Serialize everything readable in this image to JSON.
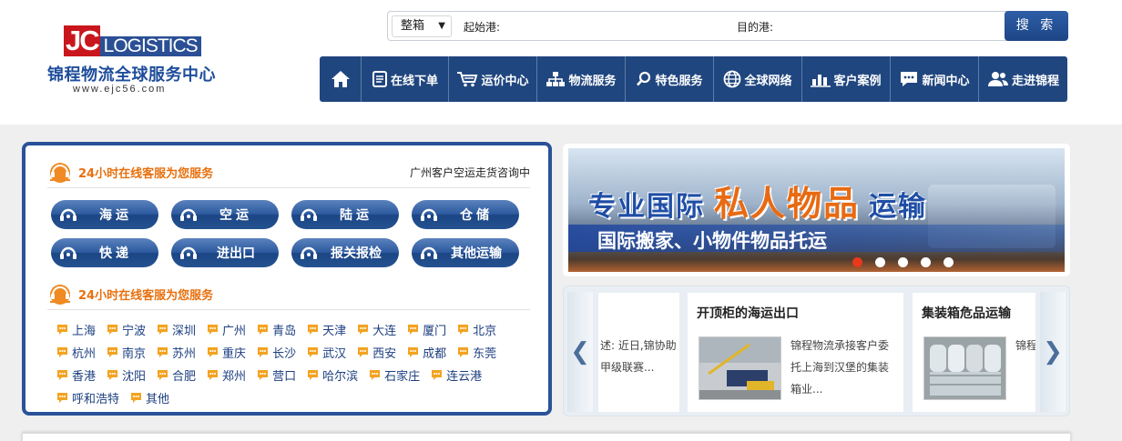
{
  "header": {
    "logo": {
      "jc": "JC",
      "logistics": "LOGISTICS",
      "cn_name": "锦程物流全球服务中心",
      "url": "www.ejc56.com"
    },
    "search": {
      "type_value": "整箱",
      "from_label": "起始港:",
      "to_label": "目的港:",
      "button_label": "搜 索"
    },
    "nav": [
      {
        "label": "",
        "icon": "home-icon"
      },
      {
        "label": "在线下单",
        "icon": "document-icon"
      },
      {
        "label": "运价中心",
        "icon": "cart-icon"
      },
      {
        "label": "物流服务",
        "icon": "sitemap-icon"
      },
      {
        "label": "特色服务",
        "icon": "search-icon"
      },
      {
        "label": "全球网络",
        "icon": "globe-icon"
      },
      {
        "label": "客户案例",
        "icon": "bar-chart-icon"
      },
      {
        "label": "新闻中心",
        "icon": "chat-icon"
      },
      {
        "label": "走进锦程",
        "icon": "users-icon"
      }
    ]
  },
  "service_panel": {
    "title1": "24小时在线客服为您服务",
    "right_text": "广州客户空运走货咨询中",
    "services": [
      "海运",
      "空运",
      "陆运",
      "仓储",
      "快递",
      "进出口",
      "报关报检",
      "其他运输"
    ],
    "title2": "24小时在线客服为您服务",
    "cities": [
      [
        "上海",
        "宁波",
        "深圳",
        "广州",
        "青岛",
        "天津",
        "大连",
        "厦门",
        "北京"
      ],
      [
        "杭州",
        "南京",
        "苏州",
        "重庆",
        "长沙",
        "武汉",
        "西安",
        "成都",
        "东莞"
      ],
      [
        "香港",
        "沈阳",
        "合肥",
        "郑州",
        "营口",
        "哈尔滨",
        "石家庄",
        "连云港"
      ],
      [
        "呼和浩特",
        "其他"
      ]
    ]
  },
  "banner": {
    "line1_a": "专业国际",
    "line1_b": "私人物品",
    "line1_c": "运输",
    "line2": "国际搬家、小物件物品托运",
    "dots": 5,
    "active_dot": 1
  },
  "news": {
    "fragment_text": "述: 近日,锦协助甲级联赛...",
    "cards": [
      {
        "title": "开顶柜的海运出口",
        "text": "锦程物流承接客户委托上海到汉堡的集装箱业..."
      },
      {
        "title": "集装箱危品运输",
        "text": "锦程物销售队,我"
      }
    ],
    "prev": "❮",
    "next": "❯"
  }
}
